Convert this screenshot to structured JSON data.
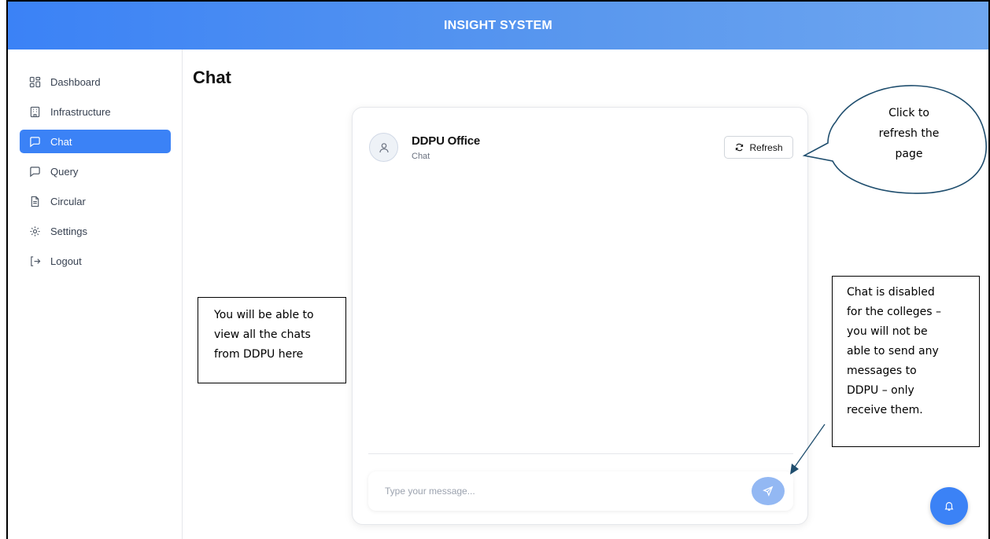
{
  "app": {
    "title": "INSIGHT SYSTEM"
  },
  "sidebar": {
    "items": [
      {
        "label": "Dashboard",
        "icon": "dashboard-icon",
        "active": false
      },
      {
        "label": "Infrastructure",
        "icon": "building-icon",
        "active": false
      },
      {
        "label": "Chat",
        "icon": "message-icon",
        "active": true
      },
      {
        "label": "Query",
        "icon": "message-icon",
        "active": false
      },
      {
        "label": "Circular",
        "icon": "document-icon",
        "active": false
      },
      {
        "label": "Settings",
        "icon": "gear-icon",
        "active": false
      },
      {
        "label": "Logout",
        "icon": "logout-icon",
        "active": false
      }
    ]
  },
  "page": {
    "title": "Chat"
  },
  "chat": {
    "contact_name": "DDPU Office",
    "contact_sub": "Chat",
    "refresh_label": "Refresh",
    "input_placeholder": "Type your message..."
  },
  "annotations": {
    "refresh_callout": [
      "Click to",
      "refresh the",
      "page"
    ],
    "left_note": [
      "You will be able to",
      "view all the chats",
      "from DDPU here"
    ],
    "right_note": [
      "Chat is disabled",
      "for the colleges –",
      "you will not be",
      "able to send any",
      "messages to",
      "DDPU – only",
      "receive them."
    ]
  },
  "colors": {
    "accent": "#3b82f6",
    "send_button": "#93b8f3",
    "callout_stroke": "#1f4e6e"
  }
}
